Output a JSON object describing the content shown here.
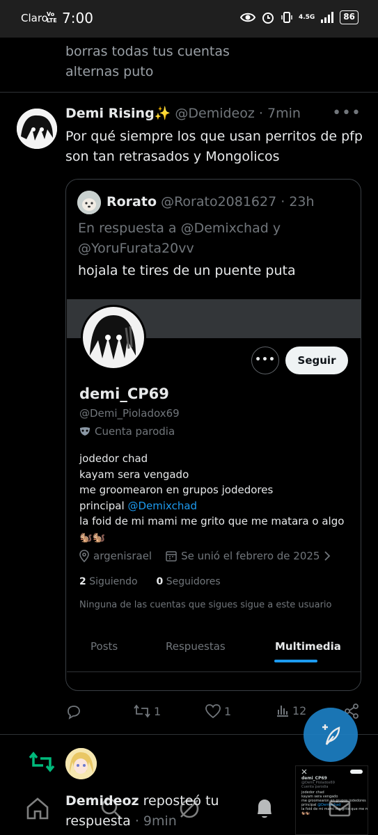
{
  "status_bar": {
    "carrier": "Claro",
    "volte_top": "Vo",
    "volte_bottom": "LTE",
    "time": "7:00",
    "network": "4.5G",
    "battery": "86"
  },
  "previous_tweet": {
    "text_line1": "borras todas tus cuentas",
    "text_line2": "alternas puto"
  },
  "tweet": {
    "author_name": "Demi Rising✨",
    "author_handle": "@Demideoz",
    "time": "· 7min",
    "text": "Por qué siempre los que usan perritos de pfp son tan retrasados y Mongolicos",
    "more_label": "•••",
    "actions": {
      "replies": "",
      "reposts": "1",
      "likes": "1",
      "views": "12"
    }
  },
  "quote": {
    "author_name": "Rorato",
    "author_handle": "@Rorato2081627",
    "time": "· 23h",
    "reply_to": "En respuesta a @Demixchad y @YoruFurata20vv",
    "text": "hojala te tires de un puente puta"
  },
  "profile_screenshot": {
    "display_name": "demi_CP69",
    "handle": "@Demi_Pioladox69",
    "parody_label": "Cuenta parodia",
    "more_button": "•••",
    "follow_button": "Seguir",
    "bio_line1": "jodedor chad",
    "bio_line2": "kayam sera vengado",
    "bio_line3": "me groomearon en grupos jodedores",
    "bio_line4_prefix": "principal ",
    "bio_line4_mention": "@Demixchad",
    "bio_line5": "la foid de mi mami me grito que me matara o algo",
    "bio_line6": "🐿️🐿️",
    "location": "argenisrael",
    "joined": "Se unió el febrero de 2025",
    "following_count": "2",
    "following_label": "Siguiendo",
    "followers_count": "0",
    "followers_label": "Seguidores",
    "mutual_note": "Ninguna de las cuentas que sigues sigue a este usuario",
    "tabs": [
      "Posts",
      "Respuestas",
      "Multimedia"
    ],
    "active_tab": "Multimedia"
  },
  "notification": {
    "actor": "Demideoz",
    "action": " reposteó tu respuesta",
    "time": " · 9min"
  },
  "colors": {
    "accent": "#1d9bf0",
    "repost_green": "#00ba7c",
    "muted": "#71767b"
  }
}
